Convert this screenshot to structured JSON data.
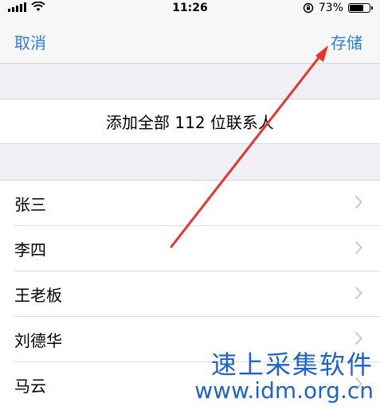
{
  "status_bar": {
    "time": "11:26",
    "battery_percent": "73%",
    "battery_level": 0.73
  },
  "nav": {
    "cancel_label": "取消",
    "save_label": "存储"
  },
  "add_all_label": "添加全部 112 位联系人",
  "contacts": [
    "张三",
    "李四",
    "王老板",
    "刘德华",
    "马云"
  ],
  "watermark": {
    "cn": "速上采集软件",
    "url": "www.idm.org.cn"
  },
  "colors": {
    "link_blue": "#2f7ed6",
    "annotation_red": "#e8332e",
    "watermark_blue": "#1e63c7"
  }
}
